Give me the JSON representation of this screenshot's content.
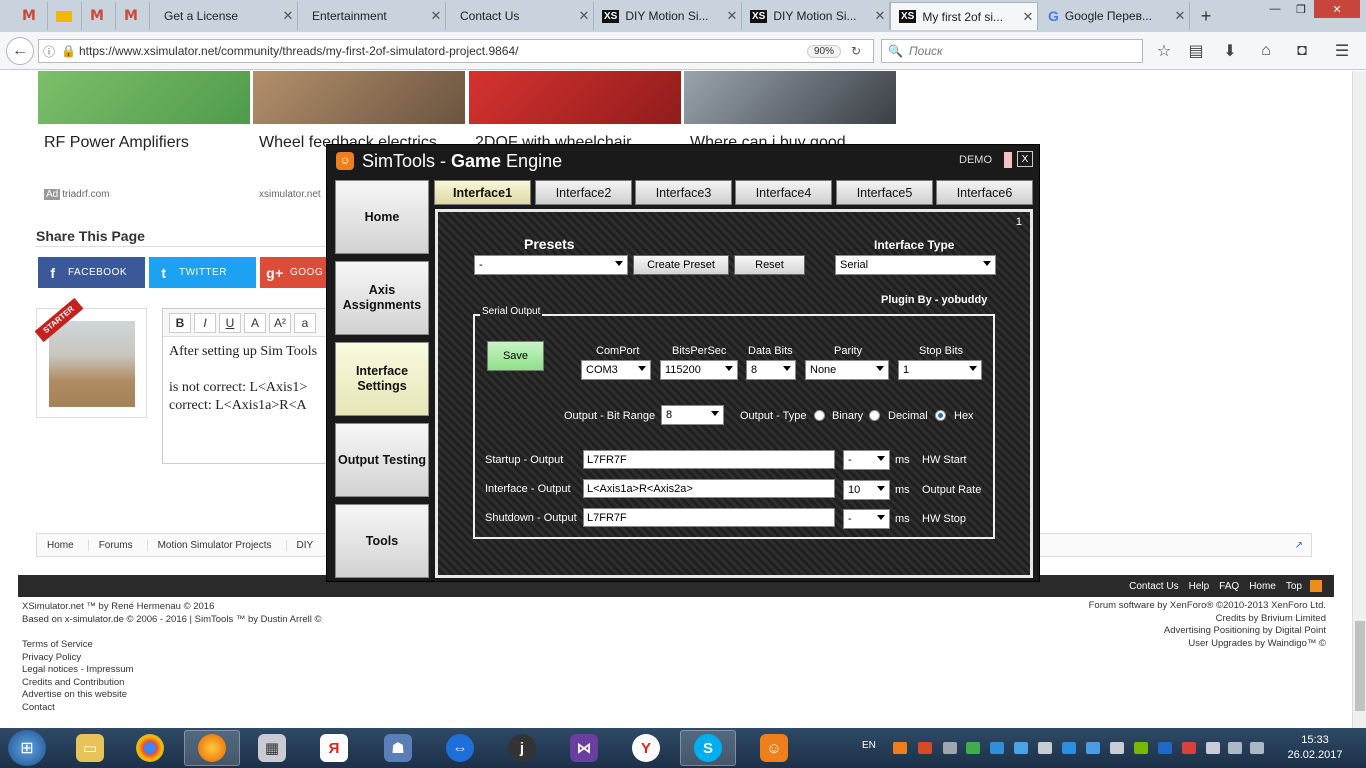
{
  "tabs": [
    {
      "icon": "gmail",
      "label": ""
    },
    {
      "icon": "mail",
      "label": ""
    },
    {
      "icon": "gmail",
      "label": ""
    },
    {
      "icon": "gmail",
      "label": ""
    },
    {
      "icon": "none",
      "label": "Get a License"
    },
    {
      "icon": "none",
      "label": "Entertainment"
    },
    {
      "icon": "none",
      "label": "Contact Us"
    },
    {
      "icon": "xs",
      "label": "DIY Motion Si..."
    },
    {
      "icon": "xs",
      "label": "DIY Motion Si..."
    },
    {
      "icon": "xs",
      "label": "My first 2of si..."
    },
    {
      "icon": "g",
      "label": "Google Перев..."
    }
  ],
  "nav": {
    "url": "https://www.xsimulator.net/community/threads/my-first-2of-simulatord-project.9864/",
    "zoom": "90%",
    "search_placeholder": "Поиск"
  },
  "ads": [
    {
      "title": "RF Power Amplifiers",
      "ad": "Ad",
      "source": "triadrf.com"
    },
    {
      "title": "Wheel feedback electrics",
      "source": "xsimulator.net"
    },
    {
      "title": "2DOF with wheelchair"
    },
    {
      "title": "Where can i buy good"
    }
  ],
  "share": {
    "heading": "Share This Page",
    "facebook": "FACEBOOK",
    "twitter": "TWITTER",
    "google": "GOOG"
  },
  "post": {
    "ribbon": "STARTER",
    "line1": "After setting up Sim Tools",
    "line2": "is not correct:  L<Axis1>",
    "line3": "correct:  L<Axis1a>R<A"
  },
  "breadcrumbs": [
    "Home",
    "Forums",
    "Motion Simulator Projects",
    "DIY"
  ],
  "footer": {
    "links": [
      "Contact Us",
      "Help",
      "FAQ",
      "Home",
      "Top"
    ],
    "left1": "XSimulator.net ™ by René Hermenau © 2016",
    "left2": "Based on x-simulator.de © 2006 - 2016 | SimTools ™ by Dustin Arrell ©",
    "left_links": [
      "Terms of Service",
      "Privacy Policy",
      "Legal notices - Impressum",
      "Credits and Contribution",
      "Advertise on this website",
      "Contact"
    ],
    "right": [
      "Forum software by XenForo® ©2010-2013 XenForo Ltd.",
      "Credits by Brivium Limited",
      "Advertising Positioning by Digital Point",
      "User Upgrades by Waindigo™ ©"
    ]
  },
  "sim": {
    "title_a": "SimTools - ",
    "title_b": "Game",
    "title_c": " Engine",
    "demo": "DEMO",
    "close": "X",
    "side": [
      "Home",
      "Axis Assignments",
      "Interface Settings",
      "Output Testing",
      "Tools"
    ],
    "itabs": [
      "Interface1",
      "Interface2",
      "Interface3",
      "Interface4",
      "Interface5",
      "Interface6"
    ],
    "panel_num": "1",
    "presets_label": "Presets",
    "presets_value": "-",
    "create_preset": "Create Preset",
    "reset": "Reset",
    "iface_type_label": "Interface Type",
    "iface_type_value": "Serial",
    "plugin_by": "Plugin By - yobuddy",
    "serial_label": "Serial Output",
    "save": "Save",
    "comport_label": "ComPort",
    "comport": "COM3",
    "bps_label": "BitsPerSec",
    "bps": "115200",
    "databits_label": "Data Bits",
    "databits": "8",
    "parity_label": "Parity",
    "parity": "None",
    "stopbits_label": "Stop Bits",
    "stopbits": "1",
    "bitrange_label": "Output - Bit Range",
    "bitrange": "8",
    "otype_label": "Output - Type",
    "binary": "Binary",
    "decimal": "Decimal",
    "hex": "Hex",
    "startup_label": "Startup - Output",
    "startup": "L7FR7F",
    "startup_ms": "-",
    "iface_label": "Interface - Output",
    "iface": "L<Axis1a>R<Axis2a>",
    "iface_ms": "10",
    "shutdown_label": "Shutdown - Output",
    "shutdown": "L7FR7F",
    "shutdown_ms": "-",
    "ms": "ms",
    "hw_start": "HW Start",
    "out_rate": "Output Rate",
    "hw_stop": "HW Stop"
  },
  "taskbar": {
    "lang": "EN",
    "time": "15:33",
    "date": "26.02.2017"
  }
}
